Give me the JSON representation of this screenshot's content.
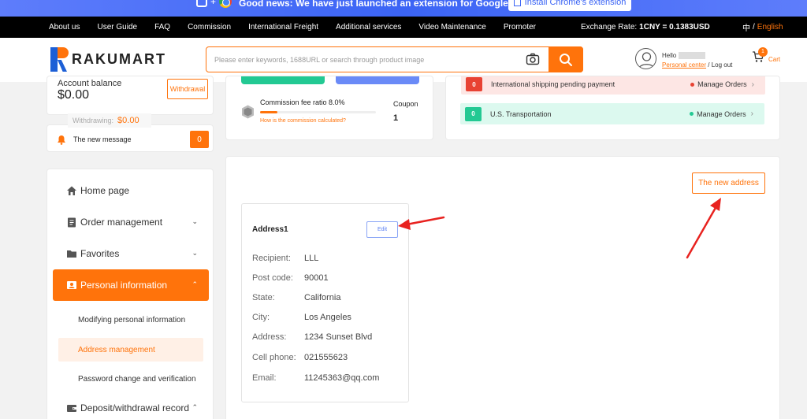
{
  "promo": {
    "news": "Good news: We have just launched an extension for Google Chrome",
    "install_label": "Install Chrome's extension"
  },
  "topnav": {
    "links": [
      "About us",
      "User Guide",
      "FAQ",
      "Commission",
      "International Freight",
      "Additional services",
      "Video Maintenance",
      "Promoter"
    ],
    "rate_label": "Exchange Rate:",
    "rate_value": "1CNY = 0.1383USD",
    "lang_cn": "中",
    "lang_sep": "/",
    "lang_en": "English"
  },
  "header": {
    "logo_text": "RAKUMART",
    "search_placeholder": "Please enter keywords, 1688URL or search through product image",
    "hello": "Hello",
    "personal_center": "Personal center",
    "logout": " / Log out",
    "cart_count": "1",
    "cart_label": "Cart"
  },
  "account": {
    "balance_label": "Account balance",
    "balance_value": "$0.00",
    "withdrawal_label": "Withdrawal",
    "withdrawing_label": "Withdrawing:",
    "withdrawing_value": "$0.00",
    "message_label": "The new message",
    "message_count": "0"
  },
  "commission": {
    "ratio_label": "Commission fee ratio 8.0%",
    "progress": 0.15,
    "how_label": "How is the commission calculated?",
    "coupon_label": "Coupon",
    "coupon_value": "1"
  },
  "orders": [
    {
      "count": "0",
      "label": "International shipping pending payment",
      "action": "Manage Orders"
    },
    {
      "count": "0",
      "label": "U.S. Transportation",
      "action": "Manage Orders"
    }
  ],
  "sidebar": {
    "items": [
      {
        "label": "Home page"
      },
      {
        "label": "Order management"
      },
      {
        "label": "Favorites"
      },
      {
        "label": "Personal information"
      },
      {
        "label": "Deposit/withdrawal record"
      }
    ],
    "subitems": [
      {
        "label": "Modifying personal information"
      },
      {
        "label": "Address management"
      },
      {
        "label": "Password change and verification"
      }
    ]
  },
  "main": {
    "new_address_label": "The new address",
    "address": {
      "title": "Address1",
      "edit_label": "Edit",
      "fields": [
        {
          "key": "Recipient:",
          "value": "LLL"
        },
        {
          "key": "Post code:",
          "value": "90001"
        },
        {
          "key": "State:",
          "value": "California"
        },
        {
          "key": "City:",
          "value": "Los Angeles"
        },
        {
          "key": "Address:",
          "value": "1234 Sunset Blvd"
        },
        {
          "key": "Cell phone:",
          "value": "021555623"
        },
        {
          "key": "Email:",
          "value": "11245363@qq.com"
        }
      ]
    }
  },
  "colors": {
    "accent": "#ff730b",
    "danger": "#e84233",
    "success": "#23c993",
    "link_blue": "#5a7ff3",
    "annotation_arrow": "#e8221f"
  }
}
